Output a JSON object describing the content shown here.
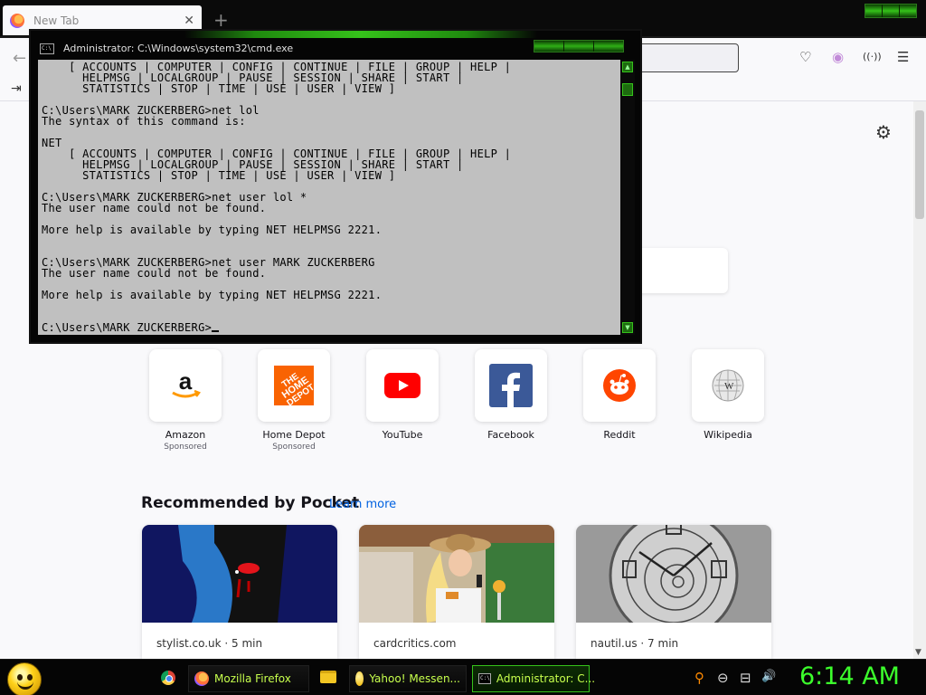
{
  "browser": {
    "tab_title": "New Tab",
    "tab_close": "✕",
    "new_tab": "+",
    "back": "←",
    "toolbar_icons": {
      "pocket": "♡",
      "account": "◉",
      "extension": "((·))",
      "menu": "☰"
    },
    "import_icon": "⇥",
    "settings": "⚙"
  },
  "top_sites": [
    {
      "name": "Amazon",
      "sub": "Sponsored",
      "icon": "amazon-icon"
    },
    {
      "name": "Home Depot",
      "sub": "Sponsored",
      "icon": "home-depot-icon"
    },
    {
      "name": "YouTube",
      "sub": "",
      "icon": "youtube-icon"
    },
    {
      "name": "Facebook",
      "sub": "",
      "icon": "facebook-icon"
    },
    {
      "name": "Reddit",
      "sub": "",
      "icon": "reddit-icon"
    },
    {
      "name": "Wikipedia",
      "sub": "",
      "icon": "wikipedia-icon"
    }
  ],
  "pocket": {
    "heading": "Recommended by Pocket",
    "learn_more": "Learn more",
    "cards": [
      {
        "source": "stylist.co.uk · 5 min"
      },
      {
        "source": "cardcritics.com"
      },
      {
        "source": "nautil.us · 7 min"
      }
    ]
  },
  "cmd": {
    "title": "Administrator: C:\\Windows\\system32\\cmd.exe",
    "icon_text": "C:\\",
    "console": "    [ ACCOUNTS | COMPUTER | CONFIG | CONTINUE | FILE | GROUP | HELP |\n      HELPMSG | LOCALGROUP | PAUSE | SESSION | SHARE | START |\n      STATISTICS | STOP | TIME | USE | USER | VIEW ]\n\nC:\\Users\\MARK ZUCKERBERG>net lol\nThe syntax of this command is:\n\nNET\n    [ ACCOUNTS | COMPUTER | CONFIG | CONTINUE | FILE | GROUP | HELP |\n      HELPMSG | LOCALGROUP | PAUSE | SESSION | SHARE | START |\n      STATISTICS | STOP | TIME | USE | USER | VIEW ]\n\nC:\\Users\\MARK ZUCKERBERG>net user lol *\nThe user name could not be found.\n\nMore help is available by typing NET HELPMSG 2221.\n\n\nC:\\Users\\MARK ZUCKERBERG>net user MARK ZUCKERBERG\nThe user name could not be found.\n\nMore help is available by typing NET HELPMSG 2221.\n\n\n",
    "prompt": "C:\\Users\\MARK ZUCKERBERG>",
    "scroll_up": "▲",
    "scroll_down": "▼"
  },
  "taskbar": {
    "buttons": [
      {
        "label": "Mozilla Firefox",
        "icon": "firefox-icon"
      },
      {
        "label": "Yahoo! Messen...",
        "icon": "yahoo-messenger-icon"
      },
      {
        "label": "Administrator: C...",
        "icon": "cmd-icon"
      }
    ],
    "tray": {
      "search": "⚲",
      "ime": "⊖",
      "network": "⊟",
      "volume": "🔊"
    },
    "clock": "6:14 AM",
    "colors": {
      "accent_green": "#35c21a",
      "clock_green": "#3cff2c",
      "label_green": "#c7ff4d"
    }
  }
}
